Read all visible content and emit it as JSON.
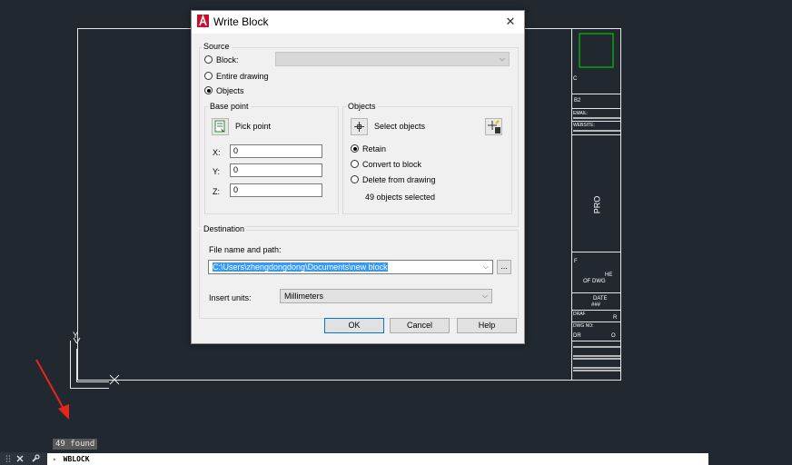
{
  "colors": {
    "background": "#212830",
    "drawing_lines": "#e6e6e6",
    "dialog_bg": "#f0f0f0",
    "accent": "#0078d7",
    "selection": "#3399ff",
    "autocad_red": "#c8102e",
    "arrow_red": "#e8251c",
    "title_block_green": "#00c000"
  },
  "dialog": {
    "title": "Write Block",
    "icon": "autocad-a-icon",
    "close_glyph": "✕",
    "source": {
      "label": "Source",
      "block_label": "Block:",
      "entire_label": "Entire drawing",
      "objects_label": "Objects",
      "selected": "Objects"
    },
    "base_point": {
      "label": "Base point",
      "pick_label": "Pick point",
      "x_label": "X:",
      "x_value": "0",
      "y_label": "Y:",
      "y_value": "0",
      "z_label": "Z:",
      "z_value": "0"
    },
    "objects": {
      "label": "Objects",
      "select_label": "Select objects",
      "retain_label": "Retain",
      "convert_label": "Convert to block",
      "delete_label": "Delete from drawing",
      "selected_option": "Retain",
      "count_text": "49 objects selected"
    },
    "destination": {
      "label": "Destination",
      "file_label": "File name and path:",
      "file_value": "C:\\Users\\zhengdongdong\\Documents\\new block",
      "browse_label": "...",
      "units_label": "Insert units:",
      "units_value": "Millimeters"
    },
    "buttons": {
      "ok": "OK",
      "cancel": "Cancel",
      "help": "Help"
    }
  },
  "title_block": {
    "t1": "C",
    "t2": "B2",
    "t3": "EMAIL:",
    "t4": "WEBSITE:",
    "t5": "PRO",
    "t6": "F",
    "t7": "HE",
    "t8": "OF DWG",
    "t9": "DATE",
    "t10": "###",
    "t11": "DRAF",
    "t12": "R",
    "t13": "DWG NO:",
    "t14": "DR",
    "t15": "O"
  },
  "ucs": {
    "y_label": "Y"
  },
  "found_text": "49 found",
  "command_line": {
    "command": "WBLOCK",
    "close_icon": "close-icon",
    "wrench_icon": "wrench-icon"
  }
}
